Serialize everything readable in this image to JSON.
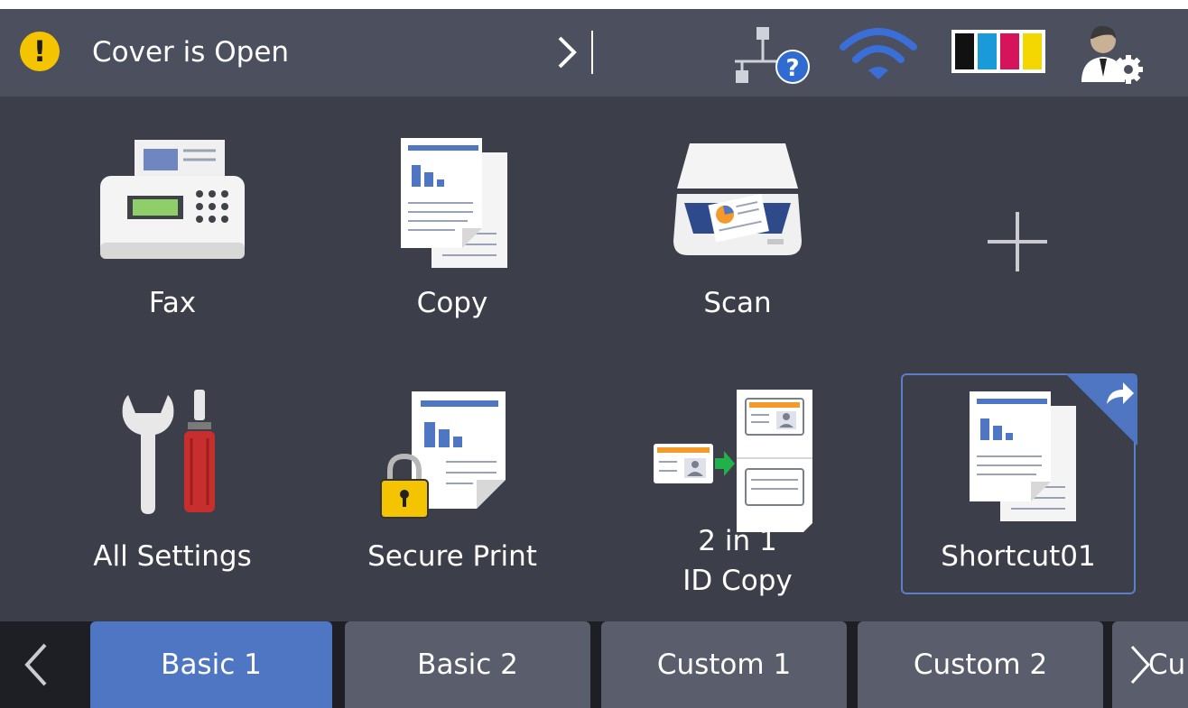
{
  "status_bar": {
    "message": "Cover is Open",
    "warning_icon": "exclamation-warning-icon",
    "network_icon": "wired-network-unknown-icon",
    "wifi_icon": "wifi-icon",
    "ink_icon": "ink-levels-icon",
    "admin_icon": "admin-settings-icon"
  },
  "ink_colors": [
    "#111111",
    "#1a9ad8",
    "#d6145b",
    "#f4d600"
  ],
  "tiles": [
    {
      "label": "Fax",
      "icon": "fax-icon"
    },
    {
      "label": "Copy",
      "icon": "copy-icon"
    },
    {
      "label": "Scan",
      "icon": "scan-icon"
    },
    {
      "label": "",
      "icon": "add-icon"
    },
    {
      "label": "All Settings",
      "icon": "settings-tools-icon"
    },
    {
      "label": "Secure Print",
      "icon": "secure-print-icon"
    },
    {
      "label_line1": "2 in 1",
      "label_line2": "ID Copy",
      "icon": "id-copy-icon"
    },
    {
      "label": "Shortcut01",
      "icon": "shortcut-copy-icon",
      "selected": true
    }
  ],
  "tabs": [
    {
      "label": "Basic 1",
      "active": true
    },
    {
      "label": "Basic 2",
      "active": false
    },
    {
      "label": "Custom 1",
      "active": false
    },
    {
      "label": "Custom 2",
      "active": false
    }
  ],
  "tab_next_partial": "Cu",
  "colors": {
    "background": "#3c3f49",
    "status_bar": "#4c4f5d",
    "accent": "#4f76c2",
    "tab": "#5a5d6b",
    "warning": "#f5c400"
  }
}
